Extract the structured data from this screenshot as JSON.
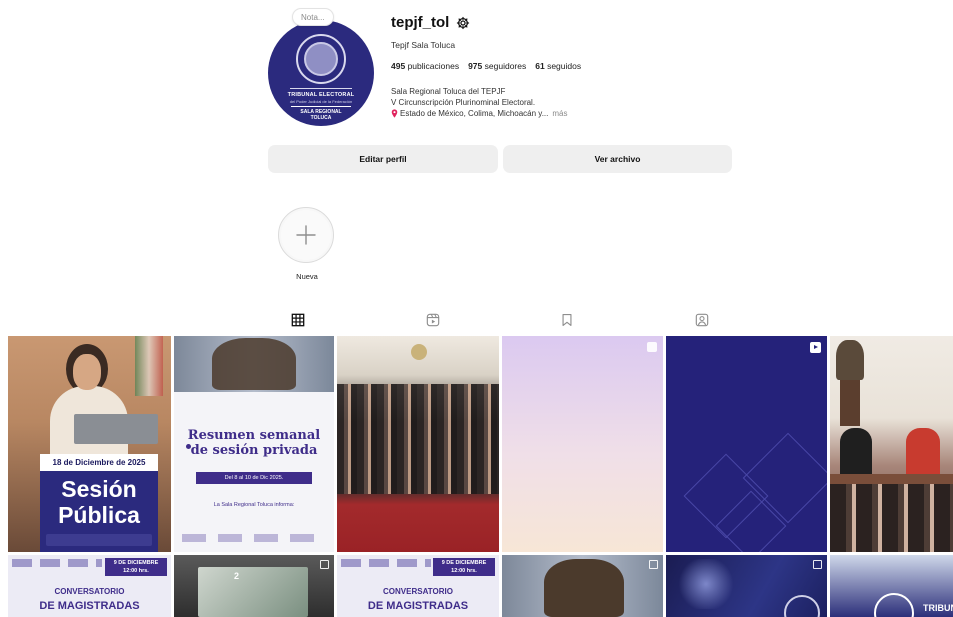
{
  "profile": {
    "note": "Nota...",
    "username": "tepjf_tol",
    "display_name": "Tepjf Sala Toluca",
    "avatar": {
      "line1": "TRIBUNAL ELECTORAL",
      "line2": "del Poder Judicial de la Federación",
      "line3": "SALA REGIONAL",
      "line4": "TOLUCA"
    },
    "stats": {
      "posts_count": "495",
      "posts_label": "publicaciones",
      "followers_count": "975",
      "followers_label": "seguidores",
      "following_count": "61",
      "following_label": "seguidos"
    },
    "bio": {
      "line1": "Sala Regional Toluca del TEPJF",
      "line2": "V Circunscripción Plurinominal Electoral.",
      "location": "Estado de México, Colima, Michoacán y...",
      "more": "más"
    }
  },
  "buttons": {
    "edit_profile": "Editar perfil",
    "view_archive": "Ver archivo"
  },
  "highlights": {
    "new_label": "Nueva"
  },
  "tabs": [
    {
      "icon": "grid-icon",
      "active": true
    },
    {
      "icon": "reels-icon",
      "active": false
    },
    {
      "icon": "saved-icon",
      "active": false
    },
    {
      "icon": "tagged-icon",
      "active": false
    }
  ],
  "posts": {
    "post1": {
      "date": "18 de Diciembre de 2025",
      "title": "Sesión Pública"
    },
    "post2": {
      "title": "Resumen semanal de sesión privada",
      "dates": "Del 8 al 10 de Dic 2025.",
      "subtitle": "La Sala Regional Toluca informa:"
    },
    "post7": {
      "badge_line1": "9 DE DICIEMBRE",
      "badge_line2": "12:00 hrs.",
      "title_line1": "CONVERSATORIO",
      "title_line2": "DE MAGISTRADAS"
    },
    "post8": {
      "number": "2"
    },
    "post9": {
      "badge_line1": "9 DE DICIEMBRE",
      "badge_line2": "12:00 hrs.",
      "title_line1": "CONVERSATORIO",
      "title_line2": "DE MAGISTRADAS"
    },
    "post12": {
      "text": "TRIBUN"
    }
  },
  "colors": {
    "brand_navy": "#2b2a7e",
    "purple": "#3f2d8a",
    "button_bg": "#efefef",
    "location_pin": "#e0245e"
  }
}
